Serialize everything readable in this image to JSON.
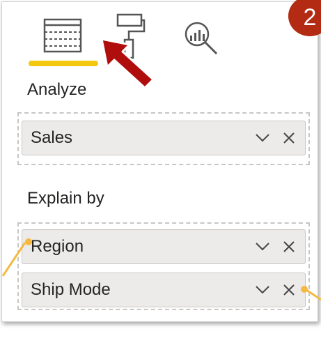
{
  "tabs": [
    {
      "icon": "fields-icon",
      "active": true
    },
    {
      "icon": "paint-roller-icon",
      "active": false
    },
    {
      "icon": "analytics-magnifier-icon",
      "active": false
    }
  ],
  "badge": {
    "number": "2"
  },
  "analyze": {
    "label": "Analyze",
    "fields": [
      {
        "name": "Sales"
      }
    ]
  },
  "explain_by": {
    "label": "Explain by",
    "fields": [
      {
        "name": "Region"
      },
      {
        "name": "Ship Mode"
      }
    ]
  },
  "colors": {
    "accent": "#F2C811",
    "arrow": "#B00D0D",
    "badge": "#B22B12",
    "callout": "#F4B942"
  }
}
